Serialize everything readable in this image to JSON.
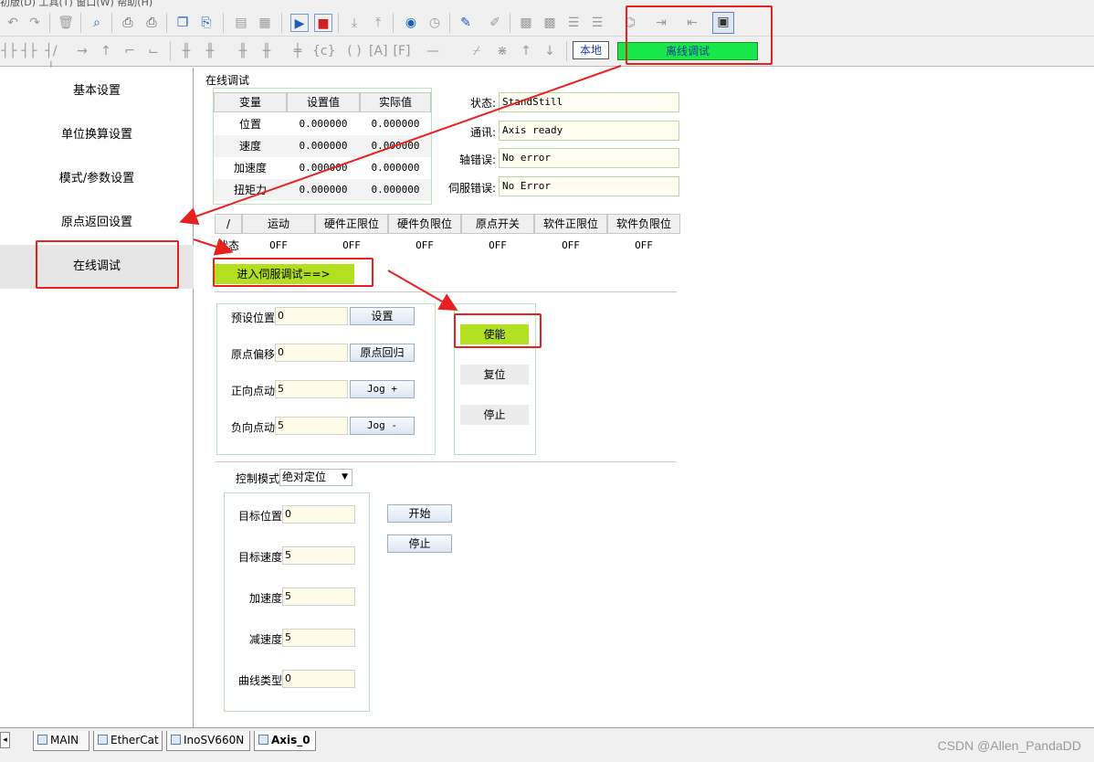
{
  "menubar_partial": "初版(D)   工具(T)   窗口(W)   帮助(H)",
  "toolbar": {
    "local_label": "本地",
    "offline_label": "离线调试"
  },
  "nav": {
    "items": [
      {
        "label": "基本设置"
      },
      {
        "label": "单位换算设置"
      },
      {
        "label": "模式/参数设置"
      },
      {
        "label": "原点返回设置"
      },
      {
        "label": "在线调试"
      }
    ]
  },
  "section_title": "在线调试",
  "axis_table": {
    "headers": [
      "变量",
      "设置值",
      "实际值"
    ],
    "rows": [
      {
        "name": "位置",
        "set": "0.000000",
        "actual": "0.000000"
      },
      {
        "name": "速度",
        "set": "0.000000",
        "actual": "0.000000"
      },
      {
        "name": "加速度",
        "set": "0.000000",
        "actual": "0.000000"
      },
      {
        "name": "扭矩力",
        "set": "0.000000",
        "actual": "0.000000"
      }
    ]
  },
  "status": {
    "state_label": "状态:",
    "state_value": "StandStill",
    "comm_label": "通讯:",
    "comm_value": "Axis ready",
    "axis_err_label": "轴错误:",
    "axis_err_value": "No error",
    "servo_err_label": "伺服错误:",
    "servo_err_value": "No Error"
  },
  "limits": {
    "headers": [
      "/",
      "运动",
      "硬件正限位",
      "硬件负限位",
      "原点开关",
      "软件正限位",
      "软件负限位"
    ],
    "row_label": "状态",
    "values": [
      "OFF",
      "OFF",
      "OFF",
      "OFF",
      "OFF",
      "OFF"
    ]
  },
  "enter_servo_label": "进入伺服调试==>",
  "jog": {
    "preset_label": "预设位置",
    "preset_value": "0",
    "set_btn": "设置",
    "origin_label": "原点偏移",
    "origin_value": "0",
    "home_btn": "原点回归",
    "fwd_label": "正向点动",
    "fwd_value": "5",
    "jog_plus": "Jog +",
    "rev_label": "负向点动",
    "rev_value": "5",
    "jog_minus": "Jog -"
  },
  "servo_buttons": {
    "enable": "使能",
    "reset": "复位",
    "stop": "停止"
  },
  "control": {
    "mode_label": "控制模式",
    "mode_value": "绝对定位",
    "target_pos_label": "目标位置",
    "target_pos": "0",
    "target_vel_label": "目标速度",
    "target_vel": "5",
    "acc_label": "加速度",
    "acc": "5",
    "dec_label": "减速度",
    "dec": "5",
    "curve_label": "曲线类型",
    "curve": "0",
    "start_btn": "开始",
    "stop_btn": "停止"
  },
  "tabs": [
    {
      "label": "MAIN"
    },
    {
      "label": "EtherCat"
    },
    {
      "label": "InoSV660N"
    },
    {
      "label": "Axis_0"
    }
  ],
  "watermark": "CSDN @Allen_PandaDD",
  "colors": {
    "offline_green": "#18e84a",
    "button_green": "#b2e021",
    "annotation_red": "#e8201e"
  }
}
